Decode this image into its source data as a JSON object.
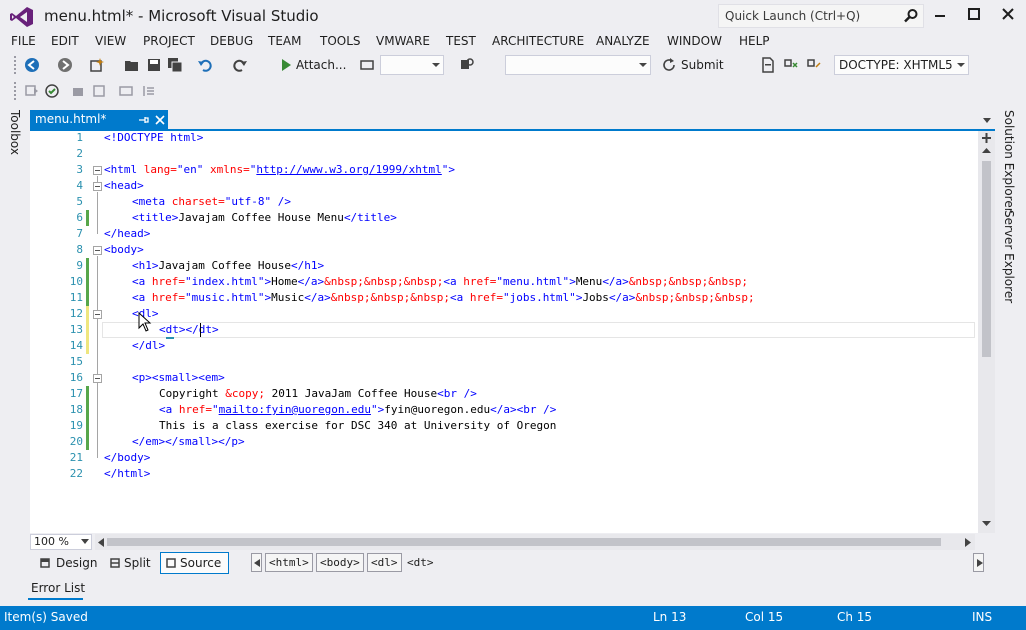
{
  "window": {
    "title": "menu.html* - Microsoft Visual Studio",
    "quick_launch_placeholder": "Quick Launch (Ctrl+Q)"
  },
  "menu": [
    "FILE",
    "EDIT",
    "VIEW",
    "PROJECT",
    "DEBUG",
    "TEAM",
    "TOOLS",
    "VMWARE",
    "TEST",
    "ARCHITECTURE",
    "ANALYZE",
    "WINDOW",
    "HELP"
  ],
  "toolbar": {
    "attach_label": "Attach...",
    "submit_label": "Submit",
    "doctype_value": "DOCTYPE: XHTML5"
  },
  "side_tabs": {
    "toolbox": "Toolbox",
    "solution_explorer": "Solution Explorer",
    "server_explorer": "Server Explorer"
  },
  "document_tab": {
    "label": "menu.html*"
  },
  "editor": {
    "line_numbers": [
      "1",
      "2",
      "3",
      "4",
      "5",
      "6",
      "7",
      "8",
      "9",
      "10",
      "11",
      "12",
      "13",
      "14",
      "15",
      "16",
      "17",
      "18",
      "19",
      "20",
      "21",
      "22"
    ],
    "lines": {
      "l1": "<!DOCTYPE html>",
      "l3_open": "<html",
      "l3_lang_attr": " lang=",
      "l3_lang_val": "\"en\"",
      "l3_xmlns_attr": " xmlns=",
      "l3_q1": "\"",
      "l3_url": "http://www.w3.org/1999/xhtml",
      "l3_q2": "\"",
      "l3_close": ">",
      "l4": "<head>",
      "l5_open": "<meta",
      "l5_attr": " charset=",
      "l5_val": "\"utf-8\"",
      "l5_close": " />",
      "l6_open": "<title>",
      "l6_text": "Javajam Coffee House Menu",
      "l6_close": "</title>",
      "l7": "</head>",
      "l8": "<body>",
      "l9_open": "<h1>",
      "l9_text": "Javajam Coffee House",
      "l9_close": "</h1>",
      "l10_a1": "<a",
      "l10_href1": " href=",
      "l10_val1": "\"index.html\"",
      "l10_gt1": ">",
      "l10_text1": "Home",
      "l10_end1": "</a>",
      "l10_ent1": "&nbsp;&nbsp;&nbsp;",
      "l10_a2": "<a",
      "l10_href2": " href=",
      "l10_val2": "\"menu.html\"",
      "l10_gt2": ">",
      "l10_text2": "Menu",
      "l10_end2": "</a>",
      "l10_ent2": "&nbsp;&nbsp;&nbsp;",
      "l11_a1": "<a",
      "l11_href1": " href=",
      "l11_val1": "\"music.html\"",
      "l11_gt1": ">",
      "l11_text1": "Music",
      "l11_end1": "</a>",
      "l11_ent1": "&nbsp;&nbsp;&nbsp;",
      "l11_a2": "<a",
      "l11_href2": " href=",
      "l11_val2": "\"jobs.html\"",
      "l11_gt2": ">",
      "l11_text2": "Jobs",
      "l11_end2": "</a>",
      "l11_ent2": "&nbsp;&nbsp;&nbsp;",
      "l12": "<dl>",
      "l13_open": "<dt>",
      "l13_close": "</dt>",
      "l14": "</dl>",
      "l16": "<p><small><em>",
      "l17_text1": "Copyright ",
      "l17_ent": "&copy;",
      "l17_text2": " 2011 JavaJam Coffee House",
      "l17_br": "<br />",
      "l18_a": "<a",
      "l18_href": " href=",
      "l18_q1": "\"",
      "l18_url": "mailto:fyin@uoregon.edu",
      "l18_q2": "\"",
      "l18_gt": ">",
      "l18_text": "fyin@uoregon.edu",
      "l18_end": "</a><br />",
      "l19": "This is a class exercise for DSC 340 at University of Oregon",
      "l20": "</em></small></p>",
      "l21": "</body>",
      "l22": "</html>"
    }
  },
  "zoom": "100 %",
  "view_buttons": {
    "design": "Design",
    "split": "Split",
    "source": "Source"
  },
  "breadcrumbs": [
    "<html>",
    "<body>",
    "<dl>",
    "<dt>"
  ],
  "error_list_label": "Error List",
  "status": {
    "message": "Item(s) Saved",
    "line": "Ln 13",
    "col": "Col 15",
    "ch": "Ch 15",
    "mode": "INS"
  },
  "colors": {
    "accent": "#007acc",
    "tag_delimiter": "#0000ff",
    "element_name": "#800000",
    "attribute_name": "#ff0000",
    "line_number": "#2b91af"
  }
}
